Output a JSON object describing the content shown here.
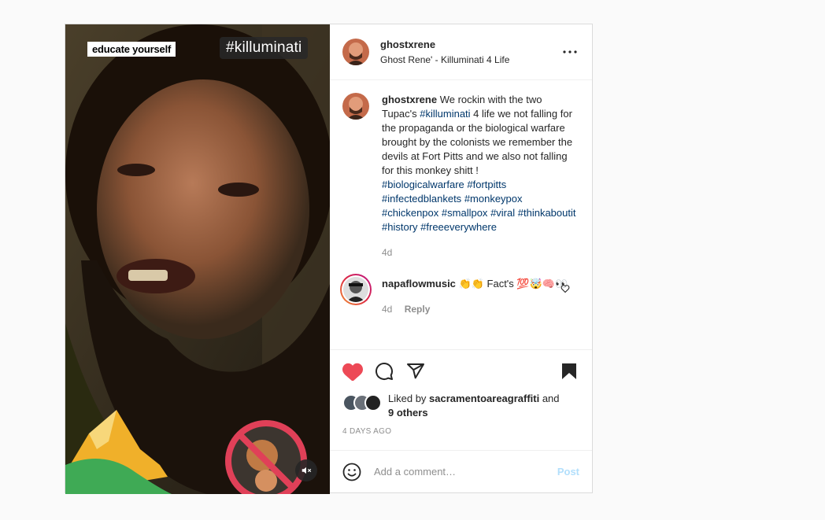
{
  "media": {
    "sticker_educate": "educate yourself",
    "sticker_tag": "#killuminati"
  },
  "header": {
    "username": "ghostxrene",
    "subtitle": "Ghost Rene' - Killuminati 4 Life",
    "more_icon": "more-horizontal-icon"
  },
  "caption": {
    "username": "ghostxrene",
    "text_before": " We rockin with the two Tupac's ",
    "inline_tag": "#killuminati",
    "text_after": " 4 life we not falling for the propaganda or the biological warfare brought by the colonists we remember the devils at Fort Pitts and we also not falling for this monkey shitt ! ",
    "tags": [
      "#biologicalwarfare",
      "#fortpitts",
      "#infectedblankets",
      "#monkeypox",
      "#chickenpox",
      "#smallpox",
      "#viral",
      "#thinkaboutit",
      "#history",
      "#freeeverywhere"
    ],
    "time": "4d"
  },
  "comment": {
    "username": "napaflowmusic",
    "text": " 👏👏 Fact's 💯🤯🧠👀",
    "time": "4d",
    "reply": "Reply"
  },
  "actions": {
    "liked_by_prefix": "Liked by ",
    "liked_by_user": "sacramentoareagraffiti",
    "liked_by_mid": " and",
    "others": "9 others",
    "date": "4 DAYS AGO"
  },
  "add_comment": {
    "placeholder": "Add a comment…",
    "post": "Post"
  },
  "colors": {
    "heart": "#ed4956",
    "tag": "#00376b",
    "post_disabled": "#b2dffc"
  }
}
